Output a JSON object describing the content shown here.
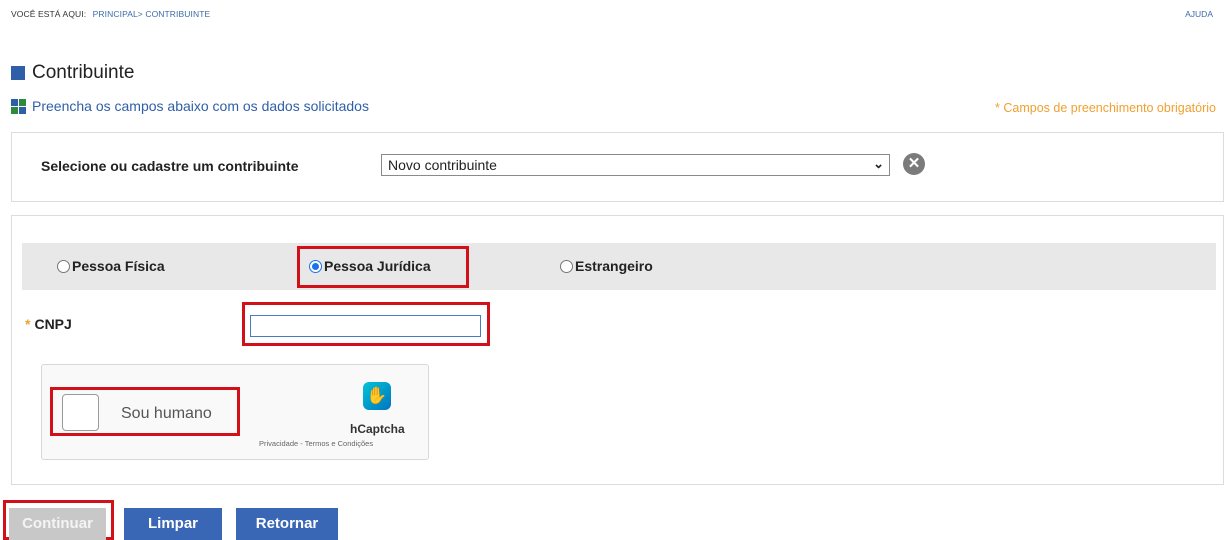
{
  "breadcrumb": {
    "prefix": "VOCÊ ESTÁ AQUI:",
    "path": "PRINCIPAL> CONTRIBUINTE"
  },
  "help_link": "AJUDA",
  "page_title": "Contribuinte",
  "instructions": "Preencha os campos abaixo com os dados solicitados",
  "required_note": "* Campos de preenchimento obrigatório",
  "taxpayer_select": {
    "label": "Selecione ou cadastre um contribuinte",
    "value": "Novo contribuinte",
    "clear_icon": "close-circle-icon"
  },
  "person_types": [
    {
      "label": "Pessoa Física",
      "checked": false
    },
    {
      "label": "Pessoa Jurídica",
      "checked": true
    },
    {
      "label": "Estrangeiro",
      "checked": false
    }
  ],
  "cnpj": {
    "label": "CNPJ",
    "required_mark": "*",
    "value": ""
  },
  "captcha": {
    "checkbox_label": "Sou humano",
    "brand": "hCaptcha",
    "links": "Privacidade - Termos e Condições",
    "checked": false
  },
  "buttons": {
    "continue": "Continuar",
    "clear": "Limpar",
    "return": "Retornar"
  },
  "colors": {
    "primary_blue": "#3a67b5",
    "link_blue": "#3d6aa8",
    "required_orange": "#f0a030",
    "highlight_red": "#d2101a",
    "disabled_gray": "#c8c8c8"
  }
}
